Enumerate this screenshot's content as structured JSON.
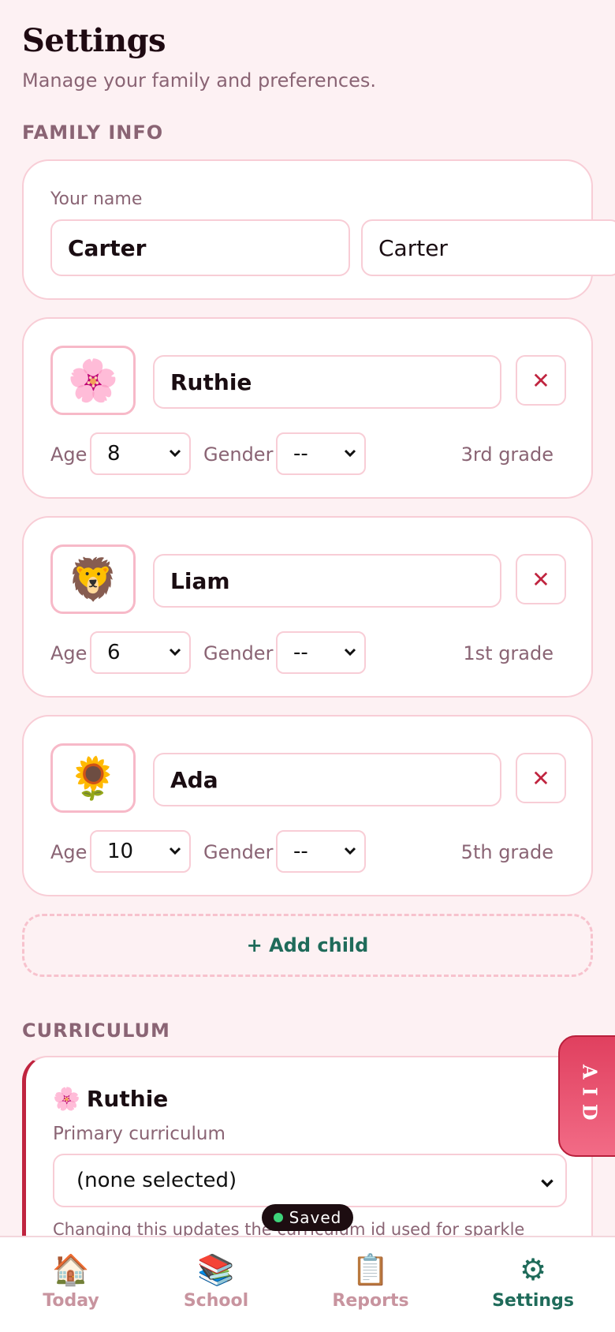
{
  "header": {
    "title": "Settings",
    "subtitle": "Manage your family and preferences."
  },
  "family": {
    "section_label": "FAMILY INFO",
    "your_name_label": "Your name",
    "your_name_value": "Carter",
    "your_name_value_2": "Carter",
    "children": [
      {
        "emoji": "🌸",
        "name": "Ruthie",
        "age_label": "Age",
        "age": "8",
        "gender_label": "Gender",
        "gender": "--",
        "grade": "3rd grade",
        "remove_icon": "✕"
      },
      {
        "emoji": "🦁",
        "name": "Liam",
        "age_label": "Age",
        "age": "6",
        "gender_label": "Gender",
        "gender": "--",
        "grade": "1st grade",
        "remove_icon": "✕"
      },
      {
        "emoji": "🌻",
        "name": "Ada",
        "age_label": "Age",
        "age": "10",
        "gender_label": "Gender",
        "gender": "--",
        "grade": "5th grade",
        "remove_icon": "✕"
      }
    ],
    "add_child_label": "+ Add child"
  },
  "curriculum": {
    "section_label": "CURRICULUM",
    "child_emoji": "🌸",
    "child_name": "Ruthie",
    "primary_label": "Primary curriculum",
    "primary_value": "(none selected)",
    "help_text": "Changing this updates the curriculum id used for sparkle"
  },
  "aid_tab": {
    "label": "AID"
  },
  "toast": {
    "label": "Saved"
  },
  "nav": {
    "items": [
      {
        "icon": "🏠",
        "label": "Today"
      },
      {
        "icon": "📚",
        "label": "School"
      },
      {
        "icon": "📋",
        "label": "Reports"
      },
      {
        "icon": "⚙",
        "label": "Settings"
      }
    ],
    "active": "Settings"
  },
  "colors": {
    "background": "#fdf1f3",
    "accent": "#1f6b5a",
    "danger": "#c0243f",
    "border": "#f8cdd6"
  }
}
